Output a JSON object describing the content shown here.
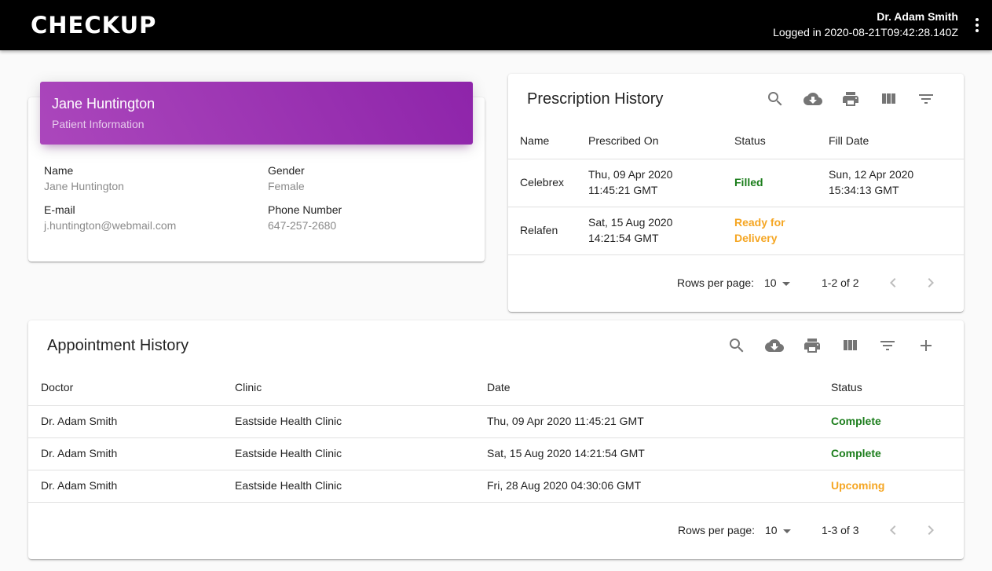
{
  "app": {
    "logo": "CHECKUP",
    "user_name": "Dr. Adam Smith",
    "login_text": "Logged in 2020-08-21T09:42:28.140Z"
  },
  "patient": {
    "name_title": "Jane Huntington",
    "subtitle": "Patient Information",
    "fields": {
      "name_label": "Name",
      "name_value": "Jane Huntington",
      "gender_label": "Gender",
      "gender_value": "Female",
      "email_label": "E-mail",
      "email_value": "j.huntington@webmail.com",
      "phone_label": "Phone Number",
      "phone_value": "647-257-2680"
    }
  },
  "prescriptions": {
    "title": "Prescription History",
    "columns": [
      "Name",
      "Prescribed On",
      "Status",
      "Fill Date"
    ],
    "rows": [
      {
        "name": "Celebrex",
        "prescribed_1": "Thu, 09 Apr 2020",
        "prescribed_2": "11:45:21 GMT",
        "status_1": "Filled",
        "status_2": "",
        "fill_1": "Sun, 12 Apr 2020",
        "fill_2": "15:34:13 GMT"
      },
      {
        "name": "Relafen",
        "prescribed_1": "Sat, 15 Aug 2020",
        "prescribed_2": "14:21:54 GMT",
        "status_1": "Ready for",
        "status_2": "Delivery",
        "fill_1": "",
        "fill_2": ""
      }
    ],
    "rows_per_page_label": "Rows per page:",
    "rows_per_page": "10",
    "range": "1-2 of 2"
  },
  "appointments": {
    "title": "Appointment History",
    "columns": [
      "Doctor",
      "Clinic",
      "Date",
      "Status"
    ],
    "rows": [
      {
        "doctor": "Dr. Adam Smith",
        "clinic": "Eastside Health Clinic",
        "date": "Thu, 09 Apr 2020 11:45:21 GMT",
        "status": "Complete"
      },
      {
        "doctor": "Dr. Adam Smith",
        "clinic": "Eastside Health Clinic",
        "date": "Sat, 15 Aug 2020 14:21:54 GMT",
        "status": "Complete"
      },
      {
        "doctor": "Dr. Adam Smith",
        "clinic": "Eastside Health Clinic",
        "date": "Fri, 28 Aug 2020 04:30:06 GMT",
        "status": "Upcoming"
      }
    ],
    "rows_per_page_label": "Rows per page:",
    "rows_per_page": "10",
    "range": "1-3 of 3"
  },
  "icons": {
    "search": "search-icon",
    "download": "cloud-download-icon",
    "print": "print-icon",
    "columns": "view-column-icon",
    "filter": "filter-list-icon",
    "add": "add-icon",
    "prev": "chevron-left-icon",
    "next": "chevron-right-icon",
    "more": "more-vert-icon"
  },
  "colors": {
    "header_gradient_start": "#ab47bc",
    "header_gradient_end": "#8e24aa",
    "status_complete": "#1b7d1b",
    "status_pending": "#f5a623"
  }
}
